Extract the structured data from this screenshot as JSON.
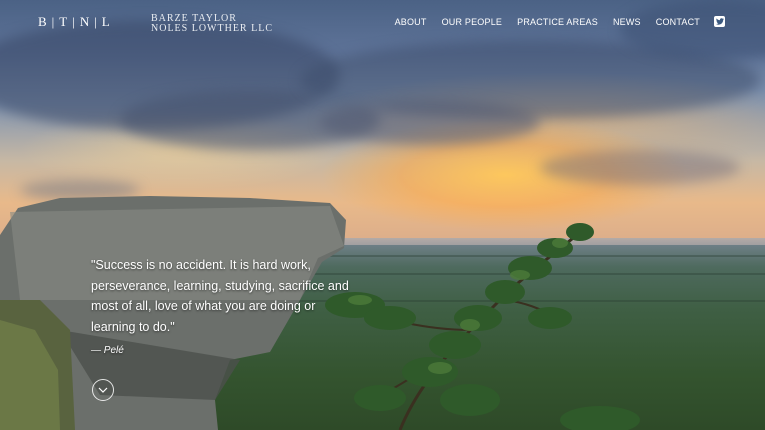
{
  "logo": {
    "mark": "B|T|N|L",
    "name_line1": "BARZE  TAYLOR",
    "name_line2": "NOLES  LOWTHER  LLC"
  },
  "nav": {
    "items": [
      {
        "label": "ABOUT"
      },
      {
        "label": "OUR PEOPLE"
      },
      {
        "label": "PRACTICE AREAS"
      },
      {
        "label": "NEWS"
      },
      {
        "label": "CONTACT"
      }
    ],
    "social_icon": "twitter-icon"
  },
  "hero": {
    "quote": "\"Success is no accident. It is hard work, perseverance, learning, studying, sacrifice and most of all, love of what you are doing or learning to do.\"",
    "author": "— Pelé",
    "scroll_icon": "chevron-down-icon"
  },
  "colors": {
    "nav_text": "#ffffff",
    "sunset_glow": "#f4b45a",
    "sky_top": "#4b6285"
  }
}
